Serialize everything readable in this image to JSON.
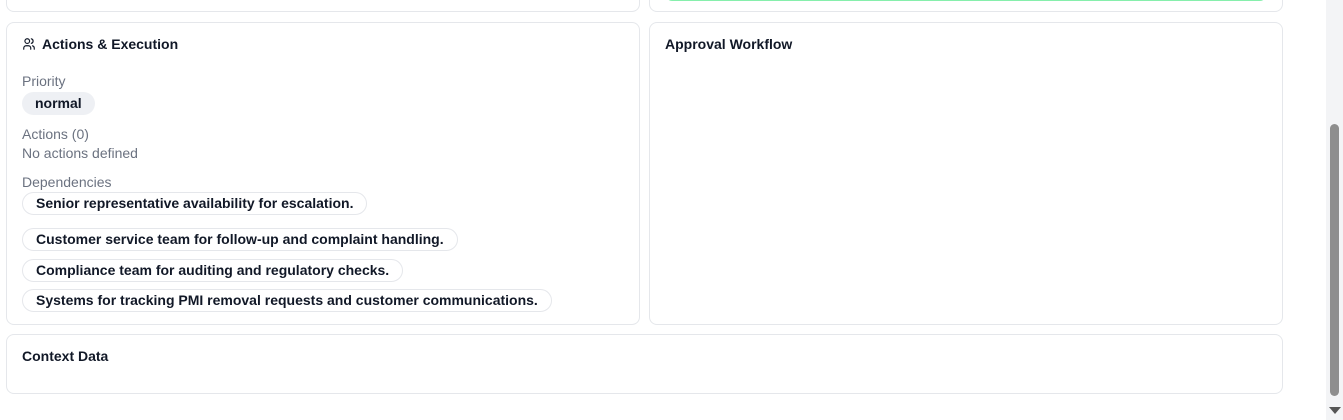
{
  "actions_card": {
    "title": "Actions & Execution",
    "title_icon": "users-icon",
    "priority_label": "Priority",
    "priority_value": "normal",
    "actions_label": "Actions (0)",
    "actions_empty": "No actions defined",
    "dependencies_label": "Dependencies",
    "dependencies": [
      "Senior representative availability for escalation.",
      "Customer service team for follow-up and complaint handling.",
      "Compliance team for auditing and regulatory checks.",
      "Systems for tracking PMI removal requests and customer communications."
    ]
  },
  "approval_card": {
    "title": "Approval Workflow"
  },
  "context_card": {
    "title": "Context Data"
  },
  "colors": {
    "border": "#e5e7eb",
    "pill_bg": "#eef0f4",
    "success_border": "#86efac",
    "muted_text": "#6b7280"
  }
}
